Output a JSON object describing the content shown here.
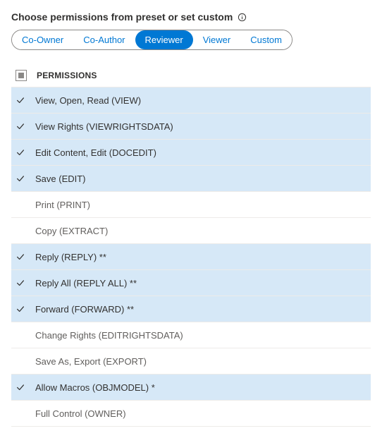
{
  "header": {
    "title": "Choose permissions from preset or set custom"
  },
  "presets": [
    {
      "label": "Co-Owner",
      "active": false
    },
    {
      "label": "Co-Author",
      "active": false
    },
    {
      "label": "Reviewer",
      "active": true
    },
    {
      "label": "Viewer",
      "active": false
    },
    {
      "label": "Custom",
      "active": false
    }
  ],
  "columns": {
    "permissions": "PERMISSIONS"
  },
  "permissions": [
    {
      "label": "View, Open, Read (VIEW)",
      "checked": true
    },
    {
      "label": "View Rights (VIEWRIGHTSDATA)",
      "checked": true
    },
    {
      "label": "Edit Content, Edit (DOCEDIT)",
      "checked": true
    },
    {
      "label": "Save (EDIT)",
      "checked": true
    },
    {
      "label": "Print (PRINT)",
      "checked": false
    },
    {
      "label": "Copy (EXTRACT)",
      "checked": false
    },
    {
      "label": "Reply (REPLY) **",
      "checked": true
    },
    {
      "label": "Reply All (REPLY ALL) **",
      "checked": true
    },
    {
      "label": "Forward (FORWARD) **",
      "checked": true
    },
    {
      "label": "Change Rights (EDITRIGHTSDATA)",
      "checked": false
    },
    {
      "label": "Save As, Export (EXPORT)",
      "checked": false
    },
    {
      "label": "Allow Macros (OBJMODEL) *",
      "checked": true
    },
    {
      "label": "Full Control (OWNER)",
      "checked": false
    }
  ]
}
